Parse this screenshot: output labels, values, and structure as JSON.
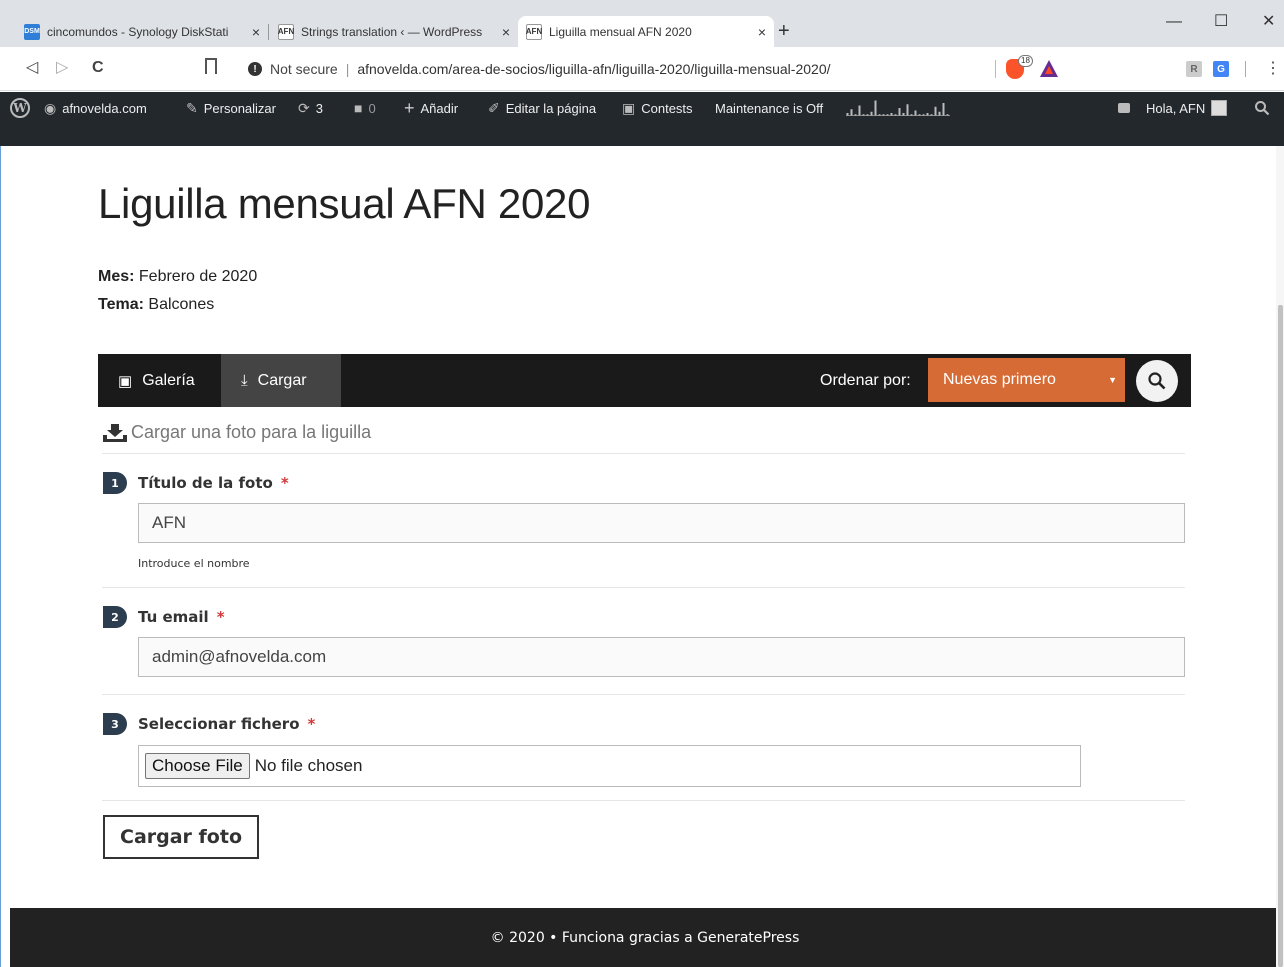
{
  "browser": {
    "tabs": [
      {
        "favicon": "DSM",
        "label": "cincomundos - Synology DiskStati",
        "close": "×"
      },
      {
        "favicon": "AFN",
        "label": "Strings translation ‹ — WordPress",
        "close": "×"
      },
      {
        "favicon": "AFN",
        "label": "Liguilla mensual AFN 2020",
        "close": "×"
      }
    ],
    "new_tab": "+",
    "window_controls": {
      "minimize": "—",
      "maximize": "☐",
      "close": "✕"
    },
    "nav": {
      "back": "◁",
      "forward": "▷",
      "reload": "C"
    },
    "security_text": "Not secure",
    "url_separator": "|",
    "url": "afnovelda.com/area-de-socios/liguilla-afn/liguilla-2020/liguilla-mensual-2020/",
    "brave_badge": "18",
    "menu": "⋮"
  },
  "adminbar": {
    "site": "afnovelda.com",
    "customize": "Personalizar",
    "updates_count": "3",
    "comments_count": "0",
    "add_new": "Añadir",
    "edit_page": "Editar la página",
    "contests": "Contests",
    "maintenance": "Maintenance is Off",
    "greeting": "Hola, AFN",
    "sparkline": [
      2,
      5,
      1,
      8,
      1,
      1,
      3,
      12,
      1,
      1,
      1,
      2,
      1,
      6,
      2,
      9,
      1,
      4,
      1,
      1,
      2,
      1,
      7,
      3,
      10,
      1
    ]
  },
  "page": {
    "title": "Liguilla mensual AFN 2020",
    "month_label": "Mes:",
    "month_value": "Febrero de 2020",
    "theme_label": "Tema:",
    "theme_value": "Balcones"
  },
  "gallery_bar": {
    "gallery": "Galería",
    "upload": "Cargar",
    "order_label": "Ordenar por:",
    "order_value": "Nuevas primero",
    "order_caret": "▼"
  },
  "form": {
    "heading": "Cargar una foto para la liguilla",
    "fields": [
      {
        "step": "1",
        "label": "Título de la foto",
        "required": "*",
        "value": "AFN",
        "hint": "Introduce el nombre"
      },
      {
        "step": "2",
        "label": "Tu email",
        "required": "*",
        "value": "admin@afnovelda.com"
      },
      {
        "step": "3",
        "label": "Seleccionar fichero",
        "required": "*",
        "button": "Choose File",
        "status": "No file chosen"
      }
    ],
    "submit": "Cargar foto"
  },
  "footer": {
    "text": "© 2020 • Funciona gracias a GeneratePress"
  },
  "colors": {
    "accent_orange": "#d66b35",
    "admin_bar": "#23282d",
    "step_badge": "#2b3d4f",
    "required": "#d23a3a"
  }
}
